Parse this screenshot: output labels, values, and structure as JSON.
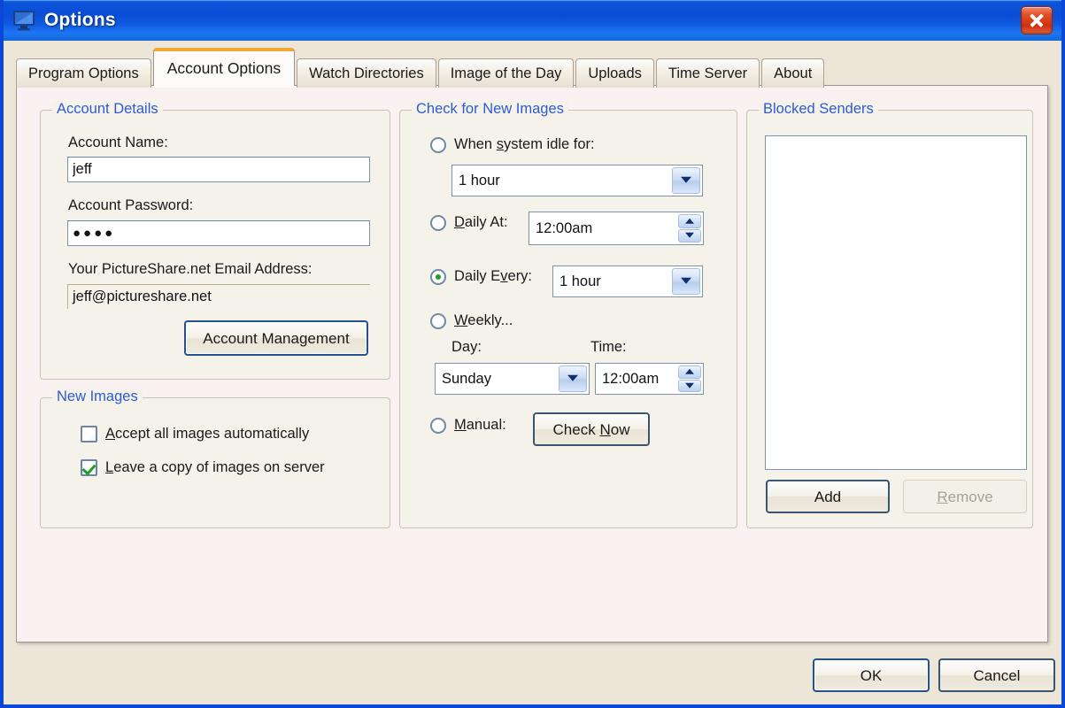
{
  "window": {
    "title": "Options",
    "icon": "monitor-icon",
    "close_label": "Close",
    "accent_blue": "#0a4ed6",
    "legend_color": "#2f5bd1",
    "tab_accent": "#f0a73a",
    "body_bg": "#ece5d8",
    "panel_bg": "#faf2f2",
    "group_bg": "#f5f2ea",
    "check_green": "#1f9e26"
  },
  "tabs": [
    {
      "label": "Program Options",
      "active": false
    },
    {
      "label": "Account Options",
      "active": true
    },
    {
      "label": "Watch Directories",
      "active": false
    },
    {
      "label": "Image of the Day",
      "active": false
    },
    {
      "label": "Uploads",
      "active": false
    },
    {
      "label": "Time Server",
      "active": false
    },
    {
      "label": "About",
      "active": false
    }
  ],
  "account_details": {
    "legend": "Account Details",
    "name_label": "Account Name:",
    "name_value": "jeff",
    "password_label": "Account Password:",
    "password_value": "●●●●",
    "email_label": "Your PictureShare.net Email Address:",
    "email_value": "jeff@pictureshare.net",
    "manage_button": "Account Management",
    "manage_button_accesskey": "c"
  },
  "new_images": {
    "legend": "New Images",
    "items": [
      {
        "label": "Accept all images automatically",
        "accesskey": "A",
        "checked": false
      },
      {
        "label": "Leave a copy of images on server",
        "accesskey": "L",
        "checked": true
      }
    ]
  },
  "check_for_new_images": {
    "legend": "Check for New Images",
    "idle": {
      "radio_label": "When system idle for:",
      "accesskey": "s",
      "selected": false,
      "value": "1 hour"
    },
    "daily_at": {
      "radio_label": "Daily At:",
      "accesskey": "D",
      "selected": false,
      "value": "12:00am"
    },
    "daily_every": {
      "radio_label": "Daily Every:",
      "accesskey": "v",
      "selected": true,
      "value": "1 hour"
    },
    "weekly": {
      "radio_label": "Weekly...",
      "accesskey": "W",
      "selected": false,
      "day_label": "Day:",
      "day_value": "Sunday",
      "time_label": "Time:",
      "time_value": "12:00am"
    },
    "manual": {
      "radio_label": "Manual:",
      "accesskey": "M",
      "selected": false,
      "button_label": "Check Now",
      "button_accesskey": "N"
    }
  },
  "blocked_senders": {
    "legend": "Blocked Senders",
    "items": [],
    "add_button": "Add",
    "remove_button": "Remove",
    "remove_accesskey": "R",
    "remove_disabled": true
  },
  "footer": {
    "ok_label": "OK",
    "cancel_label": "Cancel"
  }
}
